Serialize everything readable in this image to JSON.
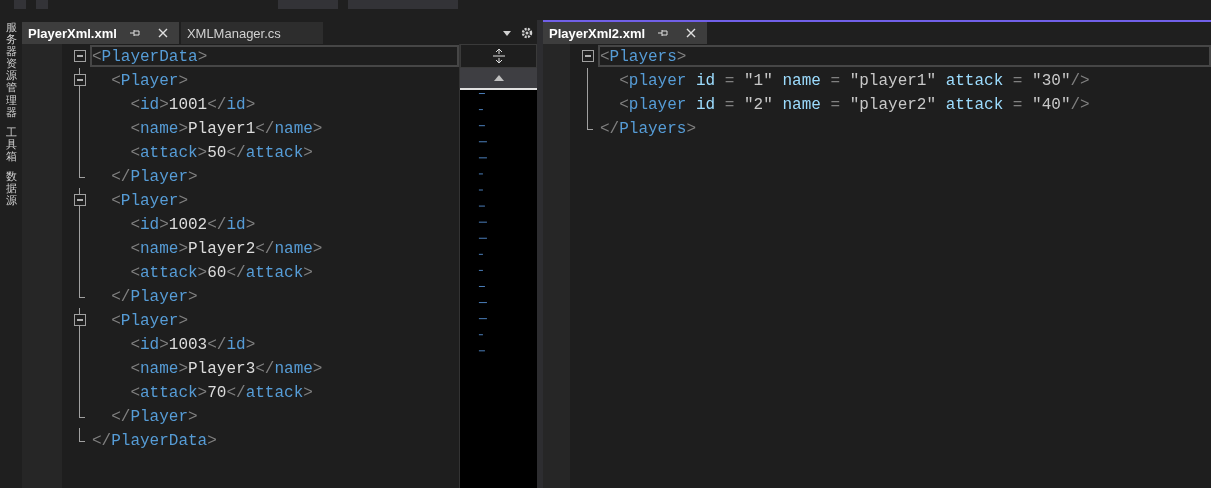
{
  "side_panels": [
    "服务器资源管理器",
    "工具箱",
    "数据源"
  ],
  "left_group": {
    "tabs": [
      {
        "label": "PlayerXml.xml",
        "selected": true
      },
      {
        "label": "XMLManager.cs",
        "selected": false
      }
    ],
    "editor": {
      "root": {
        "current": true,
        "line": [
          {
            "kind": "punct",
            "text": "<"
          },
          {
            "kind": "tag",
            "text": "PlayerData"
          },
          {
            "kind": "punct",
            "text": ">"
          }
        ],
        "end": [
          {
            "kind": "punct",
            "text": "</"
          },
          {
            "kind": "tag",
            "text": "PlayerData"
          },
          {
            "kind": "punct",
            "text": ">"
          }
        ],
        "children": [
          {
            "line": [
              {
                "kind": "punct",
                "text": "<"
              },
              {
                "kind": "tag",
                "text": "Player"
              },
              {
                "kind": "punct",
                "text": ">"
              }
            ],
            "end": [
              {
                "kind": "punct",
                "text": "</"
              },
              {
                "kind": "tag",
                "text": "Player"
              },
              {
                "kind": "punct",
                "text": ">"
              }
            ],
            "children": [
              {
                "line": [
                  {
                    "kind": "punct",
                    "text": "<"
                  },
                  {
                    "kind": "tag",
                    "text": "id"
                  },
                  {
                    "kind": "punct",
                    "text": ">"
                  },
                  {
                    "kind": "text",
                    "text": "1001"
                  },
                  {
                    "kind": "punct",
                    "text": "</"
                  },
                  {
                    "kind": "tag",
                    "text": "id"
                  },
                  {
                    "kind": "punct",
                    "text": ">"
                  }
                ]
              },
              {
                "line": [
                  {
                    "kind": "punct",
                    "text": "<"
                  },
                  {
                    "kind": "tag",
                    "text": "name"
                  },
                  {
                    "kind": "punct",
                    "text": ">"
                  },
                  {
                    "kind": "text",
                    "text": "Player1"
                  },
                  {
                    "kind": "punct",
                    "text": "</"
                  },
                  {
                    "kind": "tag",
                    "text": "name"
                  },
                  {
                    "kind": "punct",
                    "text": ">"
                  }
                ]
              },
              {
                "line": [
                  {
                    "kind": "punct",
                    "text": "<"
                  },
                  {
                    "kind": "tag",
                    "text": "attack"
                  },
                  {
                    "kind": "punct",
                    "text": ">"
                  },
                  {
                    "kind": "text",
                    "text": "50"
                  },
                  {
                    "kind": "punct",
                    "text": "</"
                  },
                  {
                    "kind": "tag",
                    "text": "attack"
                  },
                  {
                    "kind": "punct",
                    "text": ">"
                  }
                ]
              }
            ]
          },
          {
            "line": [
              {
                "kind": "punct",
                "text": "<"
              },
              {
                "kind": "tag",
                "text": "Player"
              },
              {
                "kind": "punct",
                "text": ">"
              }
            ],
            "end": [
              {
                "kind": "punct",
                "text": "</"
              },
              {
                "kind": "tag",
                "text": "Player"
              },
              {
                "kind": "punct",
                "text": ">"
              }
            ],
            "children": [
              {
                "line": [
                  {
                    "kind": "punct",
                    "text": "<"
                  },
                  {
                    "kind": "tag",
                    "text": "id"
                  },
                  {
                    "kind": "punct",
                    "text": ">"
                  },
                  {
                    "kind": "text",
                    "text": "1002"
                  },
                  {
                    "kind": "punct",
                    "text": "</"
                  },
                  {
                    "kind": "tag",
                    "text": "id"
                  },
                  {
                    "kind": "punct",
                    "text": ">"
                  }
                ]
              },
              {
                "line": [
                  {
                    "kind": "punct",
                    "text": "<"
                  },
                  {
                    "kind": "tag",
                    "text": "name"
                  },
                  {
                    "kind": "punct",
                    "text": ">"
                  },
                  {
                    "kind": "text",
                    "text": "Player2"
                  },
                  {
                    "kind": "punct",
                    "text": "</"
                  },
                  {
                    "kind": "tag",
                    "text": "name"
                  },
                  {
                    "kind": "punct",
                    "text": ">"
                  }
                ]
              },
              {
                "line": [
                  {
                    "kind": "punct",
                    "text": "<"
                  },
                  {
                    "kind": "tag",
                    "text": "attack"
                  },
                  {
                    "kind": "punct",
                    "text": ">"
                  },
                  {
                    "kind": "text",
                    "text": "60"
                  },
                  {
                    "kind": "punct",
                    "text": "</"
                  },
                  {
                    "kind": "tag",
                    "text": "attack"
                  },
                  {
                    "kind": "punct",
                    "text": ">"
                  }
                ]
              }
            ]
          },
          {
            "line": [
              {
                "kind": "punct",
                "text": "<"
              },
              {
                "kind": "tag",
                "text": "Player"
              },
              {
                "kind": "punct",
                "text": ">"
              }
            ],
            "end": [
              {
                "kind": "punct",
                "text": "</"
              },
              {
                "kind": "tag",
                "text": "Player"
              },
              {
                "kind": "punct",
                "text": ">"
              }
            ],
            "children": [
              {
                "line": [
                  {
                    "kind": "punct",
                    "text": "<"
                  },
                  {
                    "kind": "tag",
                    "text": "id"
                  },
                  {
                    "kind": "punct",
                    "text": ">"
                  },
                  {
                    "kind": "text",
                    "text": "1003"
                  },
                  {
                    "kind": "punct",
                    "text": "</"
                  },
                  {
                    "kind": "tag",
                    "text": "id"
                  },
                  {
                    "kind": "punct",
                    "text": ">"
                  }
                ]
              },
              {
                "line": [
                  {
                    "kind": "punct",
                    "text": "<"
                  },
                  {
                    "kind": "tag",
                    "text": "name"
                  },
                  {
                    "kind": "punct",
                    "text": ">"
                  },
                  {
                    "kind": "text",
                    "text": "Player3"
                  },
                  {
                    "kind": "punct",
                    "text": "</"
                  },
                  {
                    "kind": "tag",
                    "text": "name"
                  },
                  {
                    "kind": "punct",
                    "text": ">"
                  }
                ]
              },
              {
                "line": [
                  {
                    "kind": "punct",
                    "text": "<"
                  },
                  {
                    "kind": "tag",
                    "text": "attack"
                  },
                  {
                    "kind": "punct",
                    "text": ">"
                  },
                  {
                    "kind": "text",
                    "text": "70"
                  },
                  {
                    "kind": "punct",
                    "text": "</"
                  },
                  {
                    "kind": "tag",
                    "text": "attack"
                  },
                  {
                    "kind": "punct",
                    "text": ">"
                  }
                ]
              }
            ]
          }
        ]
      }
    }
  },
  "right_group": {
    "tabs": [
      {
        "label": "PlayerXml2.xml",
        "selected": true
      }
    ],
    "editor": {
      "root": {
        "current": true,
        "line": [
          {
            "kind": "punct",
            "text": "<"
          },
          {
            "kind": "tag",
            "text": "Players"
          },
          {
            "kind": "punct",
            "text": ">"
          }
        ],
        "end": [
          {
            "kind": "punct",
            "text": "</"
          },
          {
            "kind": "tag",
            "text": "Players"
          },
          {
            "kind": "punct",
            "text": ">"
          }
        ],
        "children": [
          {
            "line": [
              {
                "kind": "punct",
                "text": "<"
              },
              {
                "kind": "tag",
                "text": "player"
              },
              {
                "kind": "attr",
                "text": "id"
              },
              {
                "kind": "punct",
                "text": " = "
              },
              {
                "kind": "value",
                "text": "\"1\""
              },
              {
                "kind": "attr",
                "text": "name"
              },
              {
                "kind": "punct",
                "text": " = "
              },
              {
                "kind": "value",
                "text": "\"player1\""
              },
              {
                "kind": "attr",
                "text": "attack"
              },
              {
                "kind": "punct",
                "text": " = "
              },
              {
                "kind": "value",
                "text": "\"30\""
              },
              {
                "kind": "punct",
                "text": "/>"
              }
            ]
          },
          {
            "line": [
              {
                "kind": "punct",
                "text": "<"
              },
              {
                "kind": "tag",
                "text": "player"
              },
              {
                "kind": "attr",
                "text": "id"
              },
              {
                "kind": "punct",
                "text": " = "
              },
              {
                "kind": "value",
                "text": "\"2\""
              },
              {
                "kind": "attr",
                "text": "name"
              },
              {
                "kind": "punct",
                "text": " = "
              },
              {
                "kind": "value",
                "text": "\"player2\""
              },
              {
                "kind": "attr",
                "text": "attack"
              },
              {
                "kind": "punct",
                "text": " = "
              },
              {
                "kind": "value",
                "text": "\"40\""
              },
              {
                "kind": "punct",
                "text": "/>"
              }
            ]
          }
        ]
      }
    }
  }
}
